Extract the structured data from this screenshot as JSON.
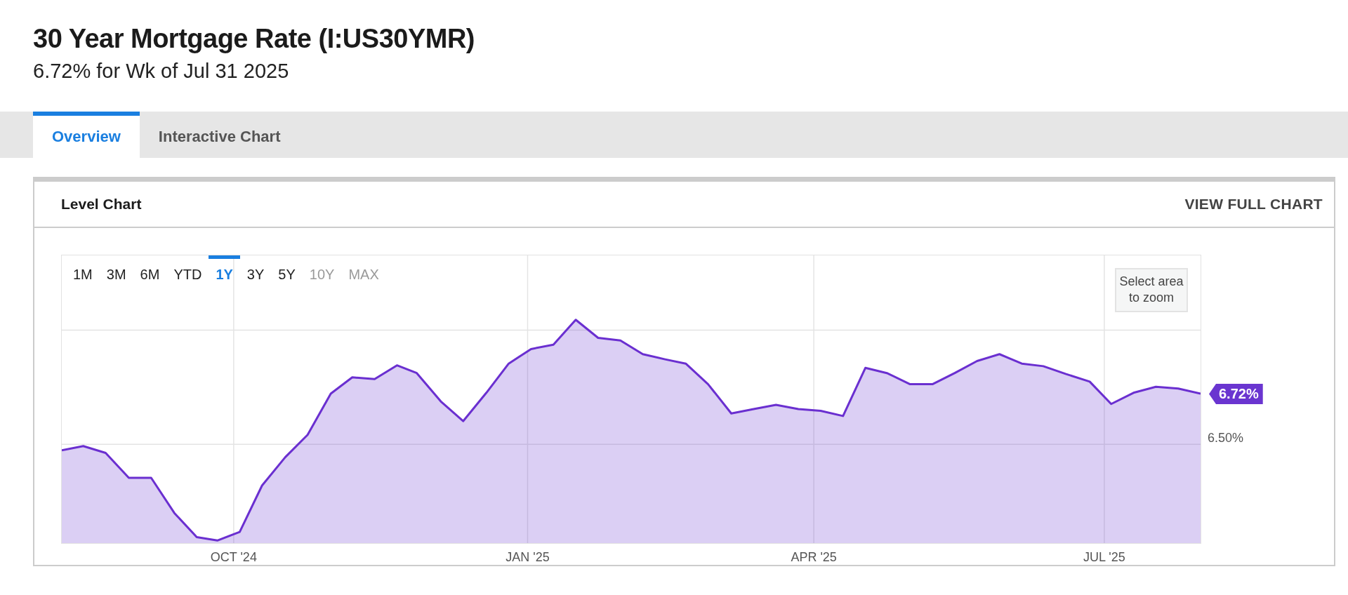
{
  "header": {
    "title": "30 Year Mortgage Rate (I:US30YMR)",
    "subtitle": "6.72% for Wk of Jul 31 2025"
  },
  "tabs": [
    {
      "label": "Overview",
      "selected": true
    },
    {
      "label": "Interactive Chart",
      "selected": false
    }
  ],
  "card": {
    "title": "Level Chart",
    "link": "VIEW FULL CHART",
    "ranges": [
      {
        "label": "1M",
        "selected": false,
        "disabled": false
      },
      {
        "label": "3M",
        "selected": false,
        "disabled": false
      },
      {
        "label": "6M",
        "selected": false,
        "disabled": false
      },
      {
        "label": "YTD",
        "selected": false,
        "disabled": false
      },
      {
        "label": "1Y",
        "selected": true,
        "disabled": false
      },
      {
        "label": "3Y",
        "selected": false,
        "disabled": false
      },
      {
        "label": "5Y",
        "selected": false,
        "disabled": false
      },
      {
        "label": "10Y",
        "selected": false,
        "disabled": true
      },
      {
        "label": "MAX",
        "selected": false,
        "disabled": true
      }
    ],
    "zoom_hint": "Select area to zoom",
    "x_labels": [
      "OCT '24",
      "JAN '25",
      "APR '25",
      "JUL '25"
    ],
    "y_label": "6.50%",
    "last_value": "6.72%"
  }
}
